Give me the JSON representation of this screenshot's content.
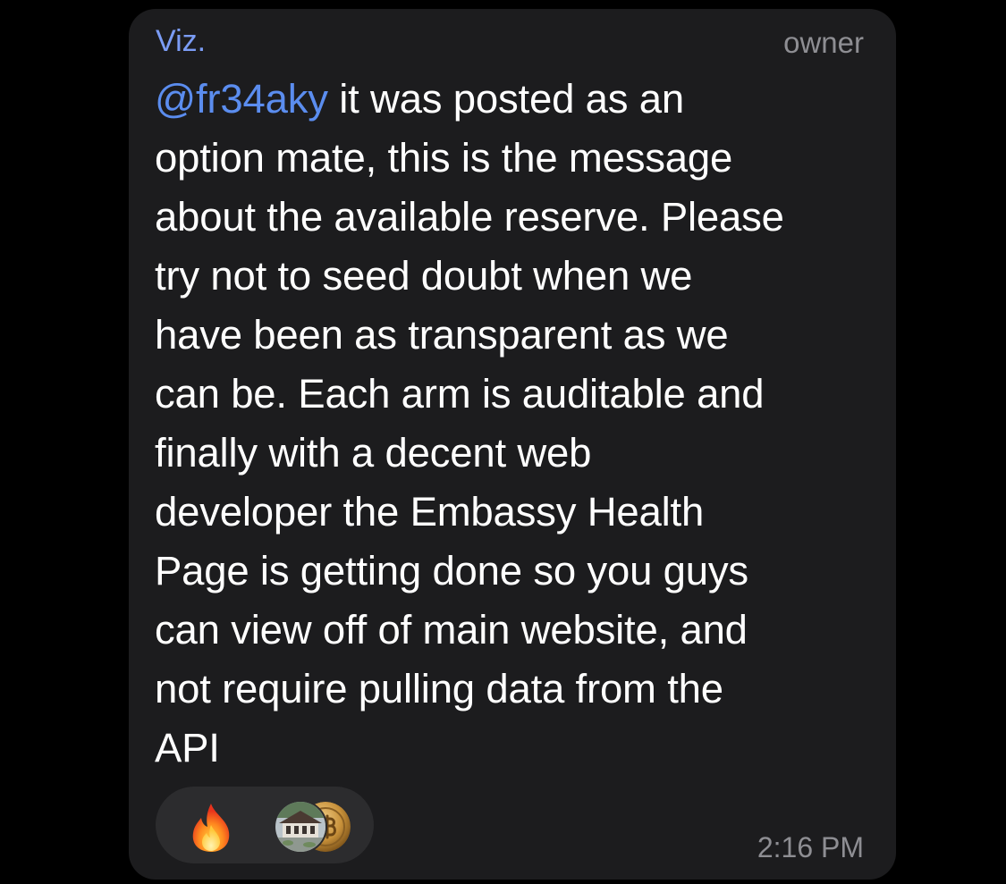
{
  "message": {
    "sender": "Viz.",
    "role": "owner",
    "mention": "@fr34aky",
    "lines": [
      " it was posted as an",
      "option mate, this is the message",
      "about the available reserve. Please",
      "try not to seed doubt when we",
      "have been as transparent as we",
      "can be. Each arm is auditable and",
      "finally with a decent web",
      "developer the Embassy Health",
      "Page is getting done so you guys",
      "can view off of main website, and",
      "not require pulling data from the",
      "API"
    ],
    "time": "2:16 PM"
  },
  "reactions": {
    "emoji_icon": "fire-icon",
    "reactor_avatars": [
      "house-photo-avatar",
      "bitcoin-coin-avatar"
    ]
  },
  "colors": {
    "background": "#000000",
    "bubble": "#1c1c1e",
    "sender": "#7b9cf5",
    "mention": "#5b8def",
    "meta": "#8e8e93",
    "reaction_pill": "#2c2c2e"
  }
}
